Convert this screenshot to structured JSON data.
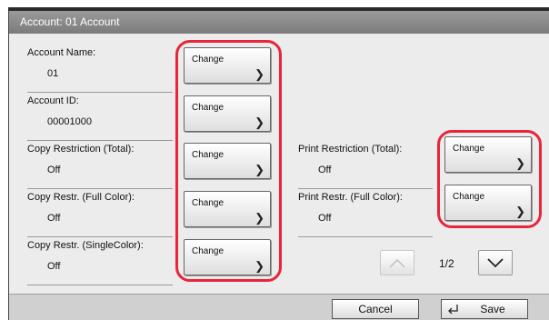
{
  "title": "Account: 01 Account",
  "fields": {
    "account_name": {
      "label": "Account Name:",
      "value": "01"
    },
    "account_id": {
      "label": "Account ID:",
      "value": "00001000"
    },
    "copy_total": {
      "label": "Copy Restriction (Total):",
      "value": "Off"
    },
    "copy_full_color": {
      "label": "Copy Restr. (Full Color):",
      "value": "Off"
    },
    "copy_single_color": {
      "label": "Copy Restr. (SingleColor):",
      "value": "Off"
    },
    "print_total": {
      "label": "Print Restriction (Total):",
      "value": "Off"
    },
    "print_full_color": {
      "label": "Print Restr. (Full Color):",
      "value": "Off"
    }
  },
  "change_label": "Change",
  "pager": {
    "text": "1/2"
  },
  "footer": {
    "cancel": "Cancel",
    "save": "Save"
  },
  "colors": {
    "highlight": "#e8253a",
    "titlebar": "#8a8a8a",
    "background": "#ececec"
  },
  "icons": {
    "up": "chevron-up-icon",
    "down": "chevron-down-icon",
    "change_arrow": "chevron-right-icon",
    "save": "enter-icon"
  }
}
